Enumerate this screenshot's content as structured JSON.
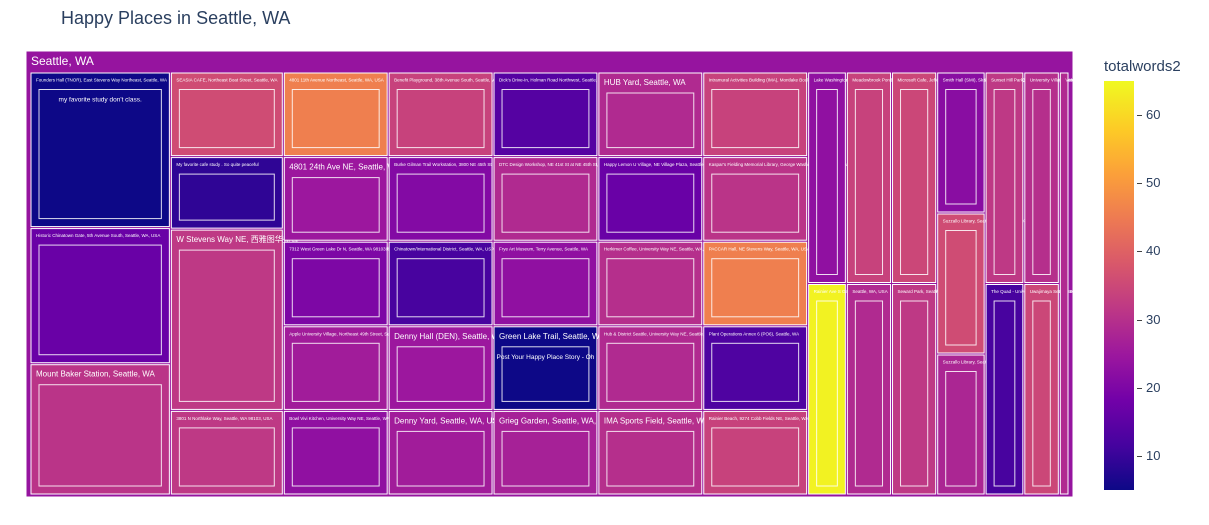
{
  "title": "Happy Places in Seattle, WA",
  "chart_data": {
    "type": "treemap",
    "root_label": "Seattle, WA",
    "color_scale": "plasma",
    "colorbar": {
      "title": "totalwords2",
      "range": [
        5,
        65
      ],
      "ticks": [
        10,
        20,
        30,
        40,
        50,
        60
      ]
    },
    "columns": [
      {
        "cells": [
          {
            "label": "Founders Hall (TNOR), East Stevens Way Northeast, Seattle, WA",
            "value": 32,
            "color": 5,
            "text": "my favorite   study   don't  class."
          },
          {
            "label": "Historic Chinatown Gate, 5th Avenue South, Seattle, WA, USA",
            "value": 28,
            "color": 17,
            "text": ""
          },
          {
            "label": "Mount Baker Station, Seattle, WA",
            "value": 27,
            "color": 31,
            "text": ""
          }
        ]
      },
      {
        "cells": [
          {
            "label": "SEASIA CAFE, Northeast Boat Street, Seattle, WA",
            "value": 14,
            "color": 36,
            "text": ""
          },
          {
            "label": "My favorite cafe  study . So quite  peaceful",
            "value": 12,
            "color": 9,
            "text": ""
          },
          {
            "label": "W Stevens Way NE, 西雅图华盛顿",
            "value": 30,
            "color": 32,
            "text": ""
          },
          {
            "label": "3801 N Northlake Way, Seattle, WA 98103, USA",
            "value": 14,
            "color": 32,
            "text": ""
          }
        ]
      },
      {
        "cells": [
          {
            "label": "4801 11th Avenue Northeast, Seattle, WA, USA",
            "value": 13,
            "color": 46,
            "text": ""
          },
          {
            "label": "4801 24th Ave NE, Seattle, WA",
            "value": 13,
            "color": 25,
            "text": ""
          },
          {
            "label": "7312 West Green Lake Dr N, Seattle, WA 98103美国",
            "value": 13,
            "color": 20,
            "text": ""
          },
          {
            "label": "Apple University Village, Northeast 49th Street, Seattle, WA, USA",
            "value": 13,
            "color": 26,
            "text": ""
          },
          {
            "label": "Bowl Vivi Kitchen, University Way NE, Seattle, WA",
            "value": 13,
            "color": 23,
            "text": ""
          }
        ]
      },
      {
        "cells": [
          {
            "label": "Benefit Playground, 38th Avenue South, Seattle, WA",
            "value": 13,
            "color": 34,
            "text": ""
          },
          {
            "label": "Burke Gilman Trail Workstation, 3800 NE 45th St, Seattle, WA, USA",
            "value": 13,
            "color": 21,
            "text": ""
          },
          {
            "label": "Chinatown/International District, Seattle, WA, USA",
            "value": 13,
            "color": 12,
            "text": ""
          },
          {
            "label": "Denny Hall (DEN), Seattle, WA, USA",
            "value": 13,
            "color": 25,
            "text": ""
          },
          {
            "label": "Denny Yard, Seattle, WA, USA",
            "value": 13,
            "color": 26,
            "text": ""
          }
        ]
      },
      {
        "cells": [
          {
            "label": "Dick's Drive-In, Holman Road Northwest, Seattle, WA",
            "value": 13,
            "color": 14,
            "text": ""
          },
          {
            "label": "DTC Design Workshop, NE 41st St at NE 45th St, Seattle, WA",
            "value": 13,
            "color": 29,
            "text": ""
          },
          {
            "label": "Frye Art Museum, Terry Avenue, Seattle, WA",
            "value": 13,
            "color": 23,
            "text": ""
          },
          {
            "label": "Green Lake Trail, Seattle, WA",
            "value": 13,
            "color": 5,
            "text": "Post Your Happy Place Story - Oh"
          },
          {
            "label": "Grieg Garden, Seattle, WA, USA",
            "value": 13,
            "color": 27,
            "text": ""
          }
        ]
      },
      {
        "cells": [
          {
            "label": "HUB Yard, Seattle, WA",
            "value": 13,
            "color": 29,
            "text": ""
          },
          {
            "label": "Happy Lemon U Village, NE Village Plaza, Seattle, WA",
            "value": 13,
            "color": 17,
            "text": ""
          },
          {
            "label": "Herkimer Coffee, University Way NE, Seattle, WA, USA",
            "value": 13,
            "color": 30,
            "text": ""
          },
          {
            "label": "Hub & District Seattle, University Way NE, Seattle, WA",
            "value": 13,
            "color": 29,
            "text": ""
          },
          {
            "label": "IMA Sports Field, Seattle, WA",
            "value": 13,
            "color": 30,
            "text": ""
          }
        ]
      },
      {
        "cells": [
          {
            "label": "Intramural Activities Building (IMA), Montlake Boulevard Northeast, Seattle, WA, USA",
            "value": 13,
            "color": 34,
            "text": ""
          },
          {
            "label": "Kaspar's Fielding Memorial Library, George Washington Lane Northeast, Seattle, WA, USA",
            "value": 13,
            "color": 31,
            "text": ""
          },
          {
            "label": "PACCAR Hall, NE Stevens Way, Seattle, WA, USA",
            "value": 13,
            "color": 46,
            "text": ""
          },
          {
            "label": "Plant Operations Annex 6 (PO6), Seattle, WA",
            "value": 13,
            "color": 13,
            "text": ""
          },
          {
            "label": "Rainier Beach, 9274 Cobb Fields NE, Seattle, WA 98105, USA",
            "value": 13,
            "color": 34,
            "text": ""
          }
        ]
      },
      {
        "cells": [
          {
            "label": "Lake Washington Blvd Trail, Seattle, WA 98118, USA",
            "value": 12,
            "color": 23,
            "text": ""
          },
          {
            "label": "Rainier Ave S Gateway Bridge Seattle, WA 98144, Seattle, WA, USA",
            "value": 12,
            "color": 64,
            "text": ""
          }
        ]
      },
      {
        "cells": [
          {
            "label": "Meadowbrook Pond, Seattle, WA",
            "value": 14,
            "color": 34,
            "text": ""
          },
          {
            "label": "Seattle, WA, USA",
            "value": 14,
            "color": 29,
            "text": ""
          }
        ]
      },
      {
        "cells": [
          {
            "label": "Microsoft Cafe, Jefferson Street Northeast, Seattle, WA",
            "value": 14,
            "color": 35,
            "text": ""
          },
          {
            "label": "Seward Park, Seattle, WA",
            "value": 14,
            "color": 32,
            "text": ""
          }
        ]
      },
      {
        "cells": [
          {
            "label": "Smith Hall (SMI), Skagit Lane, 西雅图华盛顿",
            "value": 10,
            "color": 22,
            "text": ""
          },
          {
            "label": "Suzzallo Library, Seattle, WA 98195, USA",
            "value": 10,
            "color": 36,
            "text": ""
          },
          {
            "label": "Suzzallo Library, Seattle, WA, USA",
            "value": 10,
            "color": 28,
            "text": ""
          }
        ]
      },
      {
        "cells": [
          {
            "label": "Sunset Hill Park, 34th Avenue Northwest, Seattle, WA",
            "value": 12,
            "color": 32,
            "text": ""
          },
          {
            "label": "The Quad - University of Washington, Seattle, WA",
            "value": 12,
            "color": 12,
            "text": ""
          }
        ]
      },
      {
        "cells": [
          {
            "label": "University Village, Northeast University Village Street, Seattle, WA, USA",
            "value": 11,
            "color": 30,
            "text": ""
          },
          {
            "label": "Uwajimaya Seattle, 5th Avenue South, Seattle, WA",
            "value": 11,
            "color": 35,
            "text": ""
          }
        ]
      },
      {
        "cells": [
          {
            "label": "Volunteer Park Conservatory, Seattle, WA",
            "value": 6,
            "color": 29,
            "text": ""
          }
        ]
      }
    ]
  }
}
